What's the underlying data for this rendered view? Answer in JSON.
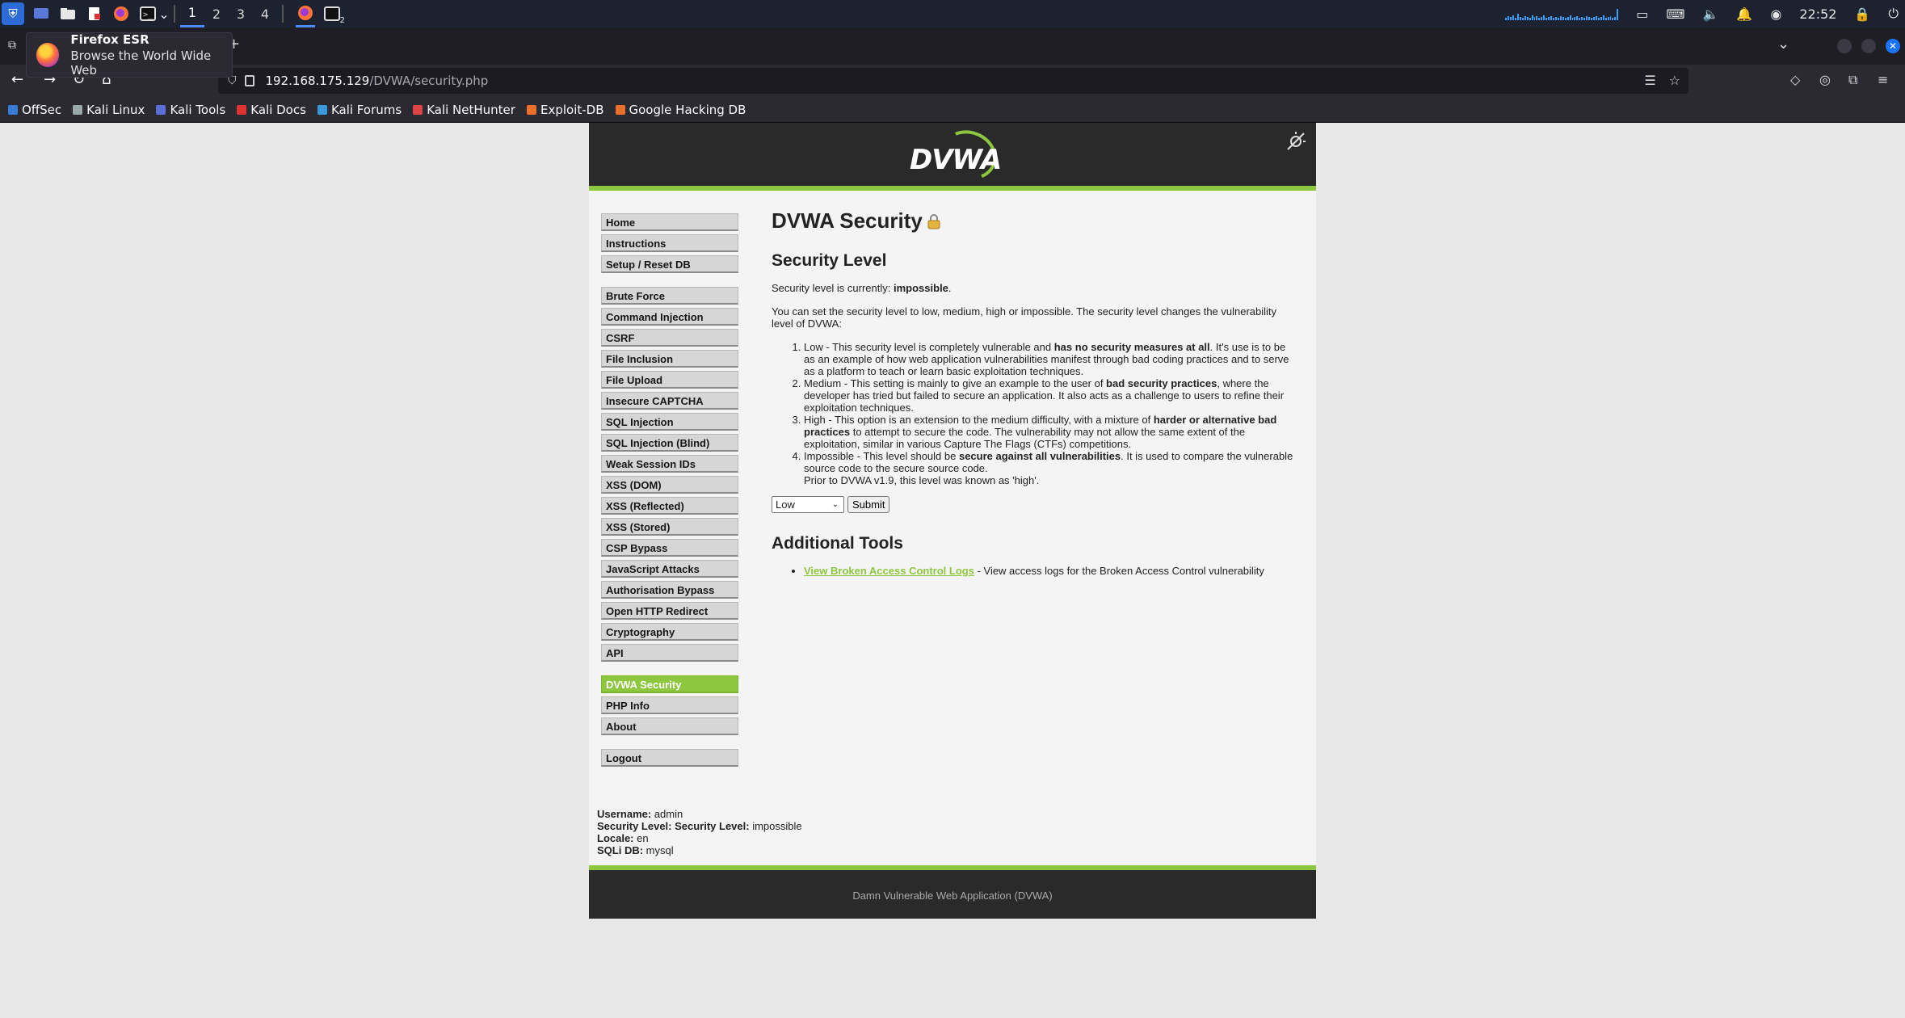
{
  "taskbar": {
    "workspaces": [
      "1",
      "2",
      "3",
      "4"
    ],
    "terminal_badge": "2",
    "clock": "22:52"
  },
  "tooltip": {
    "title": "Firefox ESR",
    "subtitle": "Browse the World Wide Web"
  },
  "browser": {
    "url_host": "192.168.175.129",
    "url_path": "/DVWA/security.php",
    "bookmarks": [
      "OffSec",
      "Kali Linux",
      "Kali Tools",
      "Kali Docs",
      "Kali Forums",
      "Kali NetHunter",
      "Exploit-DB",
      "Google Hacking DB"
    ]
  },
  "dvwa": {
    "logo_text": "DVWA",
    "menu_groups": [
      [
        "Home",
        "Instructions",
        "Setup / Reset DB"
      ],
      [
        "Brute Force",
        "Command Injection",
        "CSRF",
        "File Inclusion",
        "File Upload",
        "Insecure CAPTCHA",
        "SQL Injection",
        "SQL Injection (Blind)",
        "Weak Session IDs",
        "XSS (DOM)",
        "XSS (Reflected)",
        "XSS (Stored)",
        "CSP Bypass",
        "JavaScript Attacks",
        "Authorisation Bypass",
        "Open HTTP Redirect",
        "Cryptography",
        "API"
      ],
      [
        "DVWA Security",
        "PHP Info",
        "About"
      ],
      [
        "Logout"
      ]
    ],
    "selected_item": "DVWA Security",
    "page_title": "DVWA Security",
    "security_heading": "Security Level",
    "current_prefix": "Security level is currently: ",
    "current_level": "impossible",
    "current_suffix": ".",
    "intro": "You can set the security level to low, medium, high or impossible. The security level changes the vulnerability level of DVWA:",
    "levels": [
      {
        "pre": "Low - This security level is completely vulnerable and ",
        "bold": "has no security measures at all",
        "post": ". It's use is to be as an example of how web application vulnerabilities manifest through bad coding practices and to serve as a platform to teach or learn basic exploitation techniques."
      },
      {
        "pre": "Medium - This setting is mainly to give an example to the user of ",
        "bold": "bad security practices",
        "post": ", where the developer has tried but failed to secure an application. It also acts as a challenge to users to refine their exploitation techniques."
      },
      {
        "pre": "High - This option is an extension to the medium difficulty, with a mixture of ",
        "bold": "harder or alternative bad practices",
        "post": " to attempt to secure the code. The vulnerability may not allow the same extent of the exploitation, similar in various Capture The Flags (CTFs) competitions."
      },
      {
        "pre": "Impossible - This level should be ",
        "bold": "secure against all vulnerabilities",
        "post": ". It is used to compare the vulnerable source code to the secure source code.",
        "extra": "Prior to DVWA v1.9, this level was known as 'high'."
      }
    ],
    "select_value": "Low",
    "submit_label": "Submit",
    "tools_heading": "Additional Tools",
    "tool_link": "View Broken Access Control Logs",
    "tool_desc": " - View access logs for the Broken Access Control vulnerability",
    "info": [
      {
        "label": "Username:",
        "value": " admin"
      },
      {
        "label": "Security Level: Security Level:",
        "value": " impossible"
      },
      {
        "label": "Locale:",
        "value": " en"
      },
      {
        "label": "SQLi DB:",
        "value": " mysql"
      }
    ],
    "footer": "Damn Vulnerable Web Application (DVWA)"
  },
  "colors": {
    "dvwa_green": "#8dc73f",
    "dvwa_dark": "#2a2a2a",
    "kali_blue": "#2d6bd6"
  }
}
